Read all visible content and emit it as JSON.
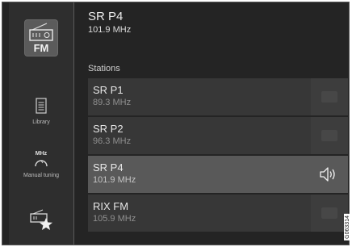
{
  "sidebar": {
    "fm_label": "FM",
    "library_label": "Library",
    "manual_tuning_top": "MHz",
    "manual_tuning_label": "Manual tuning"
  },
  "now_playing": {
    "name": "SR P4",
    "frequency": "101.9 MHz"
  },
  "stations": {
    "label": "Stations",
    "items": [
      {
        "name": "SR P1",
        "frequency": "89.3 MHz"
      },
      {
        "name": "SR P2",
        "frequency": "96.3 MHz"
      },
      {
        "name": "SR P4",
        "frequency": "101.9 MHz"
      },
      {
        "name": "RIX FM",
        "frequency": "105.9 MHz"
      }
    ]
  },
  "image_code": "G063314"
}
